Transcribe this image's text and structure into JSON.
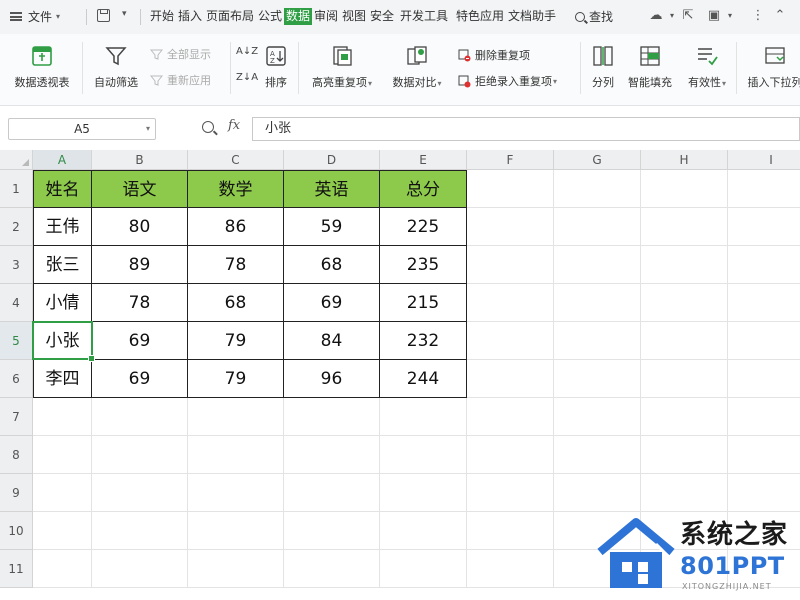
{
  "menubar": {
    "file_label": "文件",
    "tabs": [
      "开始",
      "插入",
      "页面布局",
      "公式",
      "数据",
      "审阅",
      "视图",
      "安全",
      "开发工具",
      "特色应用",
      "文档助手"
    ],
    "active_tab": "数据",
    "search_label": "查找"
  },
  "ribbon": {
    "pivot": "数据透视表",
    "autofilter": "自动筛选",
    "show_all": "全部显示",
    "reapply": "重新应用",
    "sort": "排序",
    "highlight_dup": "高亮重复项",
    "compare": "数据对比",
    "remove_dup": "删除重复项",
    "reject_dup": "拒绝录入重复项",
    "split": "分列",
    "flash_fill": "智能填充",
    "validity": "有效性",
    "insert_dropdown": "插入下拉列"
  },
  "formula_bar": {
    "name_box": "A5",
    "fx_label": "fx",
    "content": "小张"
  },
  "sheet": {
    "columns": [
      "A",
      "B",
      "C",
      "D",
      "E",
      "F",
      "G",
      "H",
      "I"
    ],
    "rows": [
      "1",
      "2",
      "3",
      "4",
      "5",
      "6",
      "7",
      "8",
      "9",
      "10",
      "11"
    ],
    "selected_cell": "A5",
    "header_fill": "#8dc94a",
    "table": [
      [
        "姓名",
        "语文",
        "数学",
        "英语",
        "总分"
      ],
      [
        "王伟",
        "80",
        "86",
        "59",
        "225"
      ],
      [
        "张三",
        "89",
        "78",
        "68",
        "235"
      ],
      [
        "小倩",
        "78",
        "68",
        "69",
        "215"
      ],
      [
        "小张",
        "69",
        "79",
        "84",
        "232"
      ],
      [
        "李四",
        "69",
        "79",
        "96",
        "244"
      ]
    ]
  },
  "watermark": {
    "line1": "系统之家",
    "line2": "801PPT",
    "line3": "XITONGZHIJIA.NET"
  },
  "colors": {
    "accent_green": "#2f9e44",
    "header_green": "#8dc94a",
    "watermark_blue": "#2d74d6"
  }
}
